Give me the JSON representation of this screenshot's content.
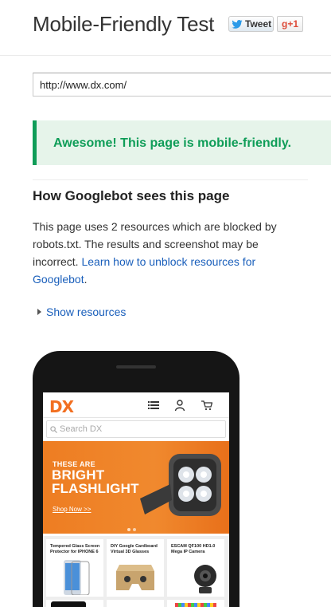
{
  "header": {
    "title": "Mobile-Friendly Test",
    "tweet_label": "Tweet",
    "gplus_label": "g+1"
  },
  "url_input": {
    "value": "http://www.dx.com/"
  },
  "result": {
    "message": "Awesome! This page is mobile-friendly."
  },
  "section": {
    "heading": "How Googlebot sees this page",
    "description": "This page uses 2 resources which are blocked by robots.txt. The results and screenshot may be incorrect.",
    "link_text": "Learn how to unblock resources for Googlebot",
    "link_suffix": ".",
    "show_resources": "Show resources"
  },
  "preview": {
    "logo": "DX",
    "search_placeholder": "Search DX",
    "hero_small": "THESE ARE",
    "hero_line1": "BRIGHT",
    "hero_line2": "FLASHLIGHT",
    "hero_link": "Shop Now >>",
    "products": [
      {
        "title": "Tempered Glass Screen Protector for IPHONE 6"
      },
      {
        "title": "DIY Google Cardboard Virtual 3D Glasses"
      },
      {
        "title": "ESCAM QF100 HD1.0 Mega IP Camera"
      }
    ],
    "colors": {
      "brand": "#f26f21",
      "success": "#0f9d58",
      "link": "#1a5fbb"
    },
    "icons": [
      "list-icon",
      "user-icon",
      "cart-icon",
      "search-icon"
    ]
  }
}
